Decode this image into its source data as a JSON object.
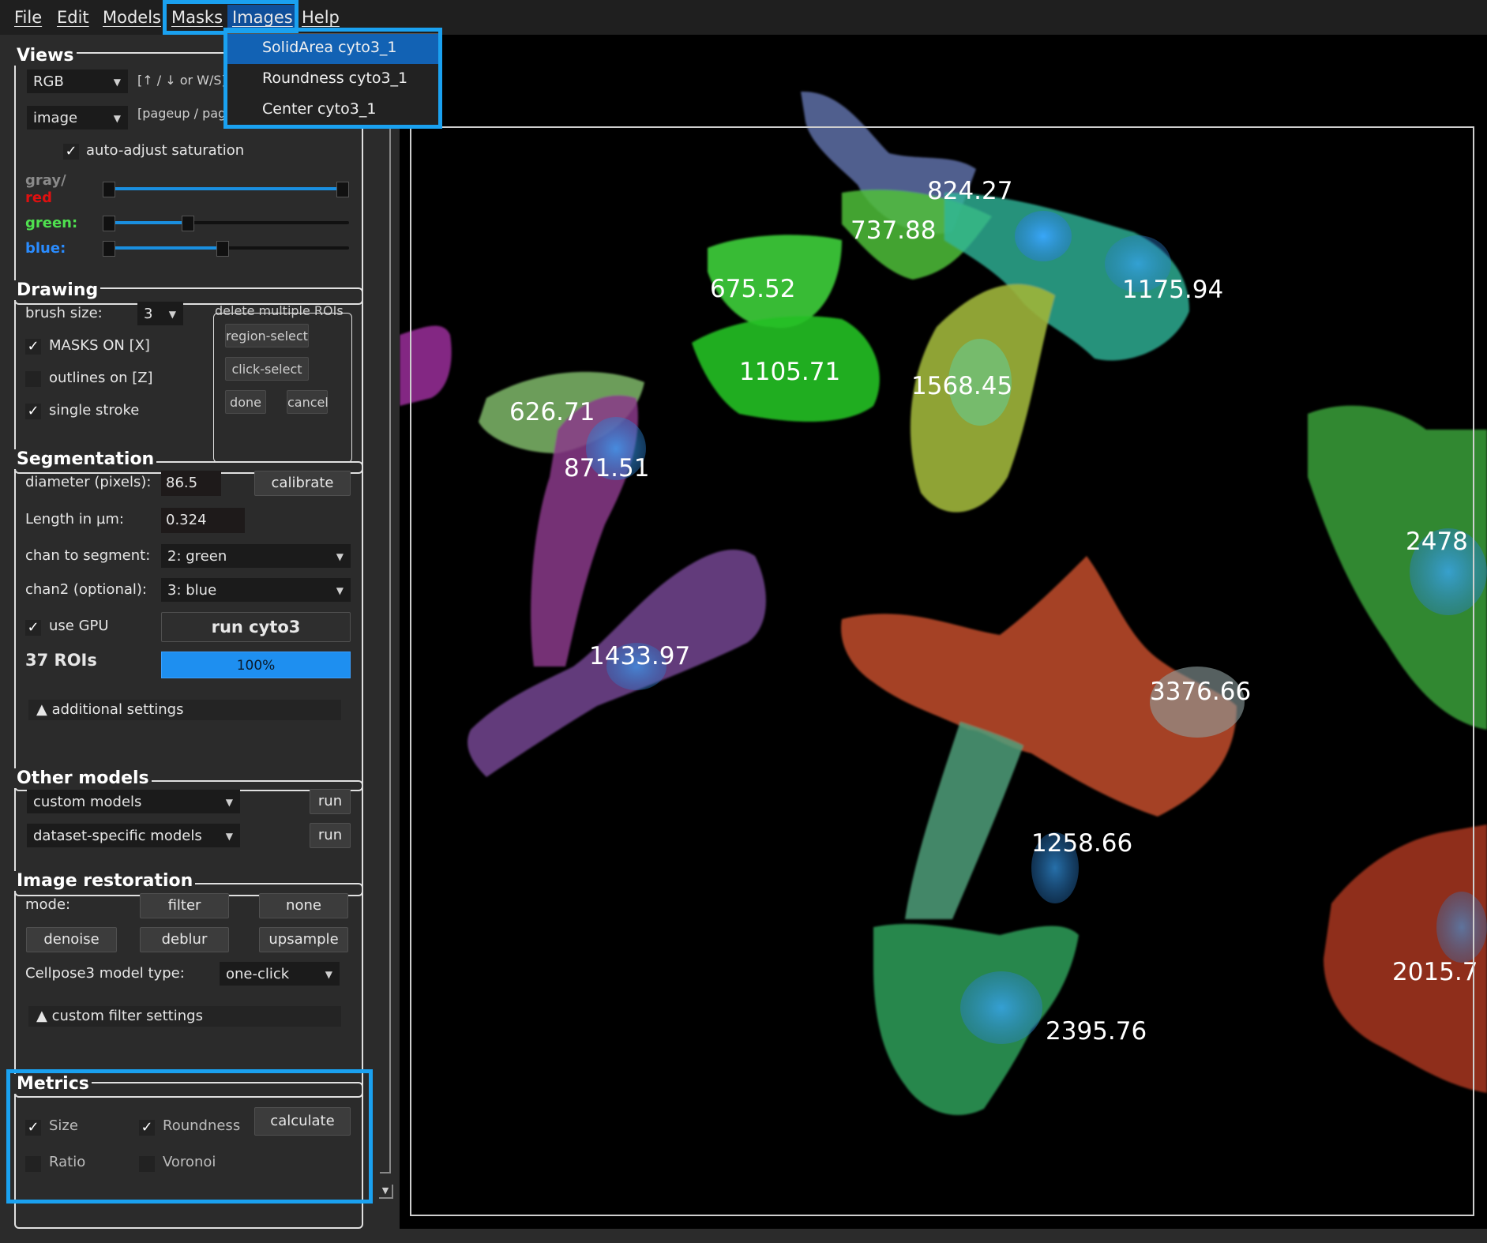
{
  "menubar": {
    "items": [
      "File",
      "Edit",
      "Models",
      "Masks",
      "Images",
      "Help"
    ]
  },
  "images_menu": {
    "items": [
      "SolidArea cyto3_1",
      "Roundness cyto3_1",
      "Center cyto3_1"
    ],
    "selected_index": 0
  },
  "views": {
    "title": "Views",
    "color_mode": "RGB",
    "color_hint": "[↑ / ↓ or W/S]",
    "view_mode": "image",
    "view_hint": "[pageup / page",
    "auto_adjust_label": "auto-adjust saturation",
    "auto_adjust_checked": true,
    "gray_label": "gray/",
    "red_label": "red",
    "green_label": "green:",
    "blue_label": "blue:"
  },
  "drawing": {
    "title": "Drawing",
    "brush_label": "brush size:",
    "brush_value": "3",
    "masks_on_label": "MASKS ON [X]",
    "masks_on_checked": true,
    "outlines_label": "outlines on [Z]",
    "outlines_checked": false,
    "single_stroke_label": "single stroke",
    "single_stroke_checked": true,
    "delete_title": "delete multiple ROIs",
    "region_select": "region-select",
    "click_select": "click-select",
    "done": "done",
    "cancel": "cancel"
  },
  "segmentation": {
    "title": "Segmentation",
    "diameter_label": "diameter (pixels):",
    "diameter_value": "86.5",
    "calibrate": "calibrate",
    "length_label": "Length in µm:",
    "length_value": "0.324",
    "chan_label": "chan to segment:",
    "chan_value": "2: green",
    "chan2_label": "chan2 (optional):",
    "chan2_value": "3: blue",
    "gpu_label": "use GPU",
    "gpu_checked": true,
    "run_button": "run cyto3",
    "roi_count": "37 ROIs",
    "progress_text": "100%",
    "progress_fraction": 1.0,
    "additional_settings": "▲ additional settings"
  },
  "other_models": {
    "title": "Other models",
    "custom": "custom models",
    "dataset": "dataset-specific models",
    "run1": "run",
    "run2": "run"
  },
  "restoration": {
    "title": "Image restoration",
    "mode_label": "mode:",
    "filter": "filter",
    "none": "none",
    "denoise": "denoise",
    "deblur": "deblur",
    "upsample": "upsample",
    "model_type_label": "Cellpose3 model type:",
    "model_type_value": "one-click",
    "custom_filter": "▲ custom filter settings"
  },
  "metrics": {
    "title": "Metrics",
    "size_label": "Size",
    "size_checked": true,
    "roundness_label": "Roundness",
    "roundness_checked": true,
    "calculate": "calculate",
    "ratio_label": "Ratio",
    "ratio_checked": false,
    "voronoi_label": "Voronoi",
    "voronoi_checked": false
  },
  "canvas": {
    "cell_values": [
      "824.27",
      "737.88",
      "675.52",
      "1175.94",
      "1105.71",
      "1568.45",
      "626.71",
      "871.51",
      "2478",
      "1433.97",
      "3376.66",
      "1258.66",
      "2015.7",
      "2395.76"
    ]
  }
}
